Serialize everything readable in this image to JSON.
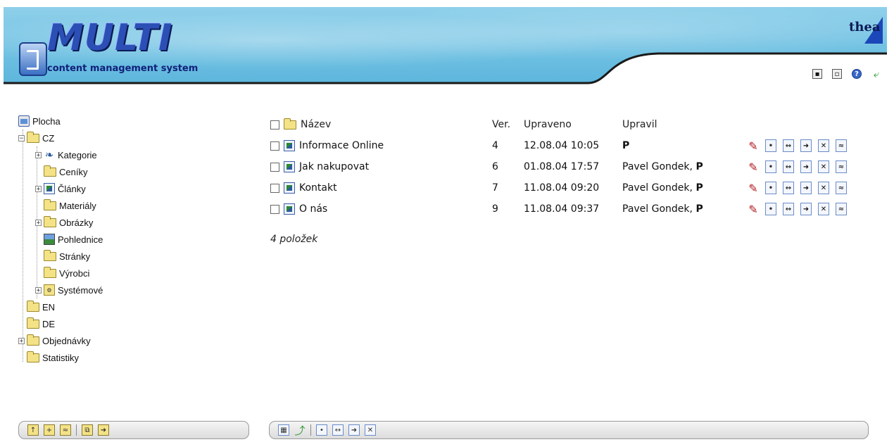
{
  "header": {
    "logo_title": "MULTI",
    "logo_subtitle": "content management system",
    "brand": "thea",
    "icons": [
      "lock-icon",
      "lock-open-icon",
      "help-icon",
      "exit-icon"
    ]
  },
  "tree": {
    "root": "Plocha",
    "cz": "CZ",
    "kategorie": "Kategorie",
    "ceniky": "Ceníky",
    "clanky": "Články",
    "materialy": "Materiály",
    "obrazky": "Obrázky",
    "pohlednice": "Pohlednice",
    "stranky": "Stránky",
    "vyrobci": "Výrobci",
    "systemove": "Systémové",
    "en": "EN",
    "de": "DE",
    "objednavky": "Objednávky",
    "statistiky": "Statistiky"
  },
  "listing": {
    "headers": {
      "name": "Název",
      "ver": "Ver.",
      "modified": "Upraveno",
      "modified_by": "Upravil"
    },
    "rows": [
      {
        "name": "Informace Online",
        "ver": "4",
        "date": "12.08.04 10:05",
        "user": "",
        "user_bold": "P"
      },
      {
        "name": "Jak nakupovat",
        "ver": "6",
        "date": "01.08.04 17:57",
        "user": "Pavel Gondek, ",
        "user_bold": "P"
      },
      {
        "name": "Kontakt",
        "ver": "7",
        "date": "11.08.04 09:20",
        "user": "Pavel Gondek, ",
        "user_bold": "P"
      },
      {
        "name": "O nás",
        "ver": "9",
        "date": "11.08.04 09:37",
        "user": "Pavel Gondek, ",
        "user_bold": "P"
      }
    ],
    "count": "4 položek"
  },
  "colors": {
    "header_sky": "#6ec0e2",
    "logo_blue": "#2b4fb5",
    "folder": "#f4e287"
  }
}
